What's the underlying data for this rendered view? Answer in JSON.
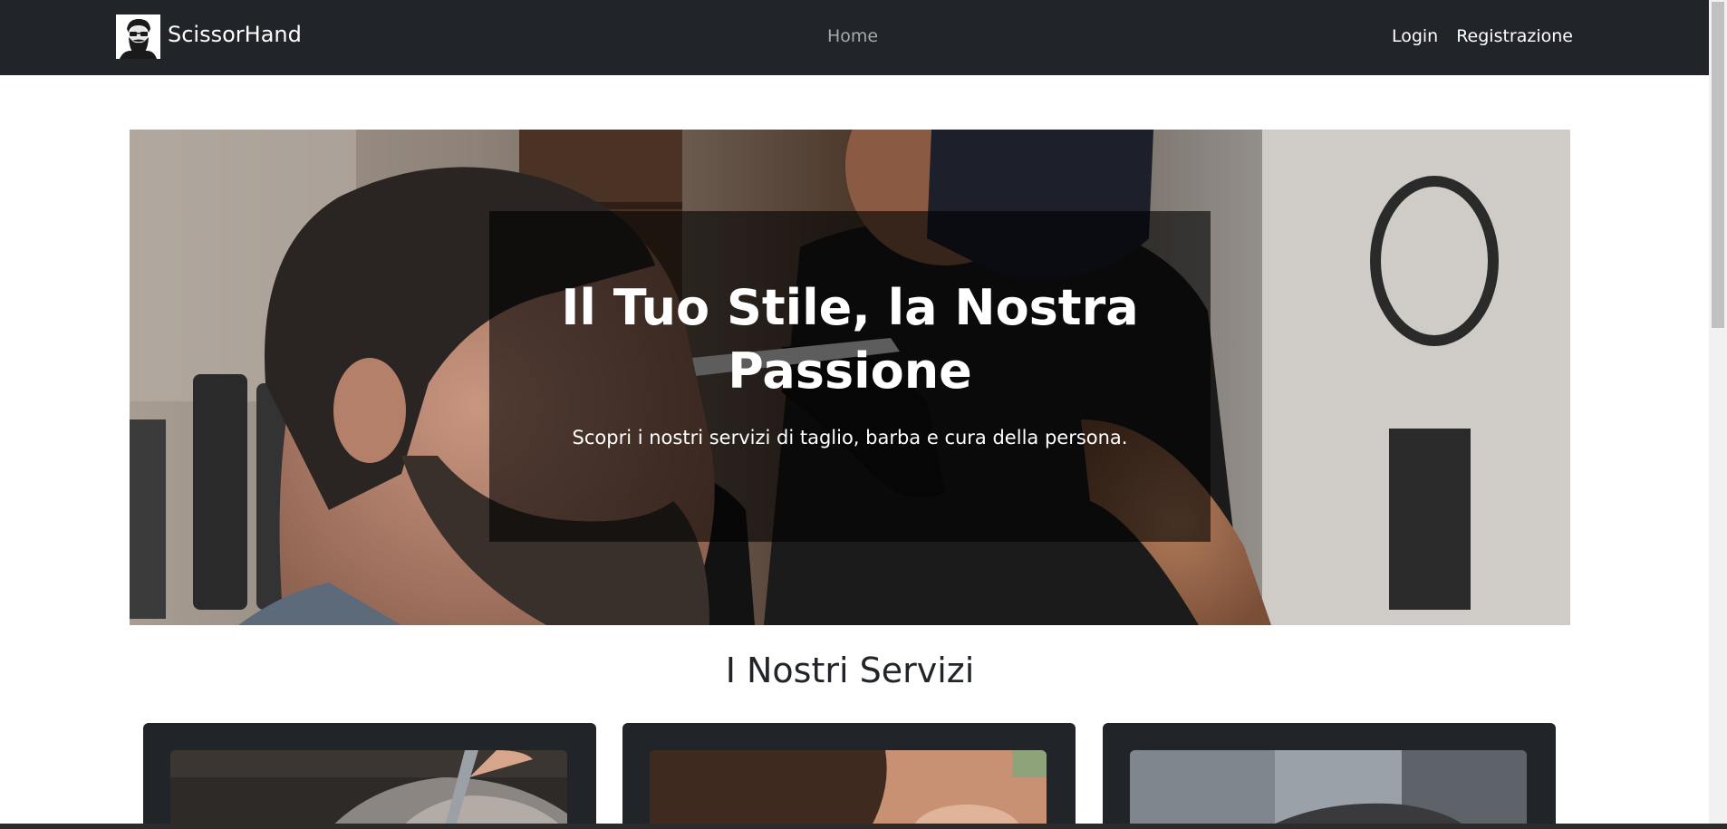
{
  "navbar": {
    "brand": "ScissorHand",
    "home": "Home",
    "login": "Login",
    "register": "Registrazione",
    "logo_icon": "bearded-man-logo",
    "background_color": "#212529"
  },
  "hero": {
    "title": "Il Tuo Stile, la Nostra Passione",
    "subtitle": "Scopri i nostri servizi di taglio, barba e cura della persona."
  },
  "services": {
    "title": "I Nostri Servizi",
    "cards": [
      {
        "image": "haircut-scissors-photo"
      },
      {
        "image": "beard-trim-photo"
      },
      {
        "image": "barber-shop-photo"
      }
    ]
  }
}
